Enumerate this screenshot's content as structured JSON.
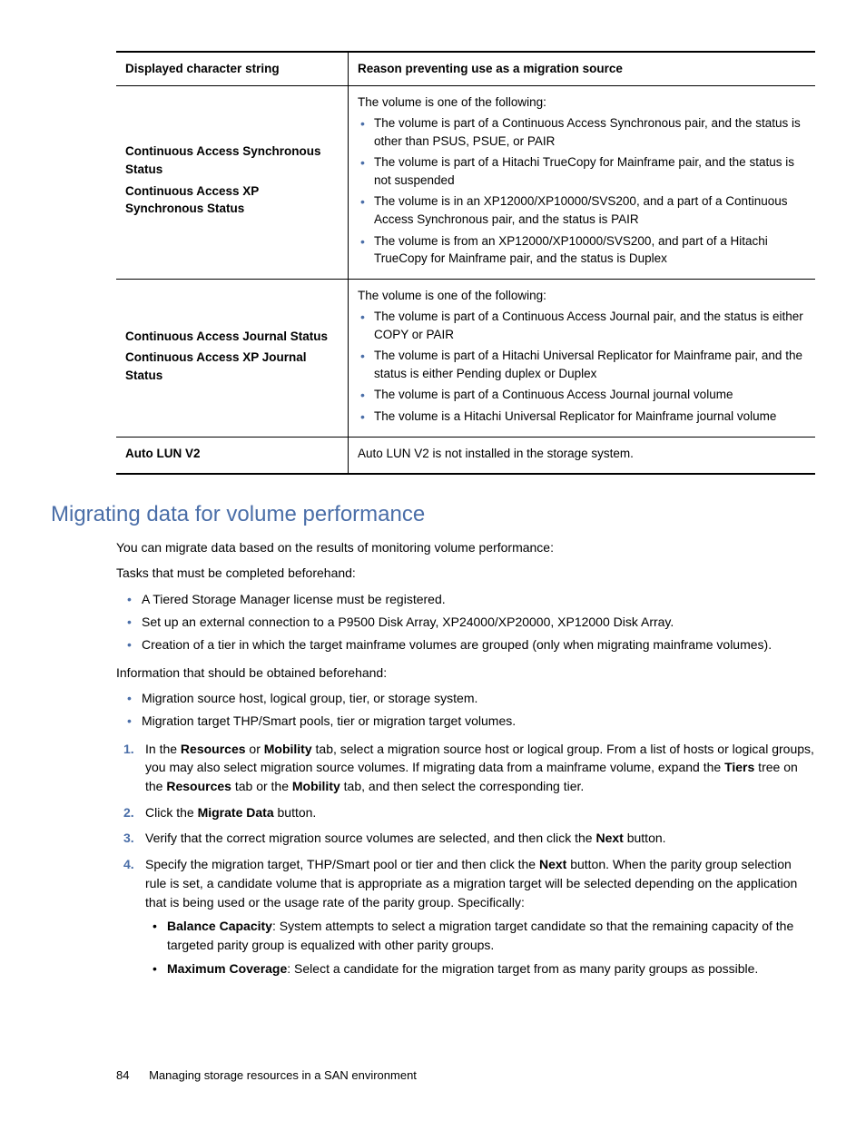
{
  "table": {
    "headers": [
      "Displayed character string",
      "Reason preventing use as a migration source"
    ],
    "rows": [
      {
        "labels": [
          "Continuous Access Synchronous Status",
          "Continuous Access XP Synchronous Status"
        ],
        "intro": "The volume is one of the following:",
        "items": [
          "The volume is part of a Continuous Access Synchronous pair, and the status is other than PSUS, PSUE, or PAIR",
          "The volume is part of a Hitachi TrueCopy for Mainframe pair, and the status is not suspended",
          "The volume is in an XP12000/XP10000/SVS200, and a part of a Continuous Access Synchronous pair, and the status is PAIR",
          "The volume is from an XP12000/XP10000/SVS200, and part of a Hitachi TrueCopy for Mainframe pair, and the status is Duplex"
        ]
      },
      {
        "labels": [
          "Continuous Access Journal Status",
          "Continuous Access XP Journal Status"
        ],
        "intro": "The volume is one of the following:",
        "items": [
          "The volume is part of a Continuous Access Journal pair, and the status is either COPY or PAIR",
          "The volume is part of a Hitachi Universal Replicator for Mainframe pair, and the status is either Pending duplex or Duplex",
          "The volume is part of a Continuous Access Journal journal volume",
          "The volume is a Hitachi Universal Replicator for Mainframe journal volume"
        ]
      },
      {
        "labels": [
          "Auto LUN V2"
        ],
        "intro": "Auto LUN V2 is not installed in the storage system.",
        "items": []
      }
    ]
  },
  "section": {
    "heading": "Migrating data for volume performance",
    "intro1": "You can migrate data based on the results of monitoring volume performance:",
    "intro2": "Tasks that must be completed beforehand:",
    "tasks": [
      "A Tiered Storage Manager license must be registered.",
      "Set up an external connection to a P9500 Disk Array, XP24000/XP20000, XP12000 Disk Array.",
      "Creation of a tier in which the target mainframe volumes are grouped (only when migrating mainframe volumes)."
    ],
    "intro3": "Information that should be obtained beforehand:",
    "info": [
      "Migration source host, logical group, tier, or storage system.",
      "Migration target THP/Smart pools, tier or migration target volumes."
    ],
    "steps": [
      {
        "pre": "In the ",
        "b1": "Resources",
        "mid1": " or ",
        "b2": "Mobility",
        "post1": " tab, select a migration source host or logical group. From a list of hosts or logical groups, you may also select migration source volumes. If migrating data from a mainframe volume, expand the ",
        "b3": "Tiers",
        "post2": " tree on the ",
        "b4": "Resources",
        "post3": " tab or the ",
        "b5": "Mobility",
        "post4": " tab, and then select the corresponding tier."
      },
      {
        "pre": "Click the ",
        "b1": "Migrate Data",
        "post1": " button."
      },
      {
        "pre": "Verify that the correct migration source volumes are selected, and then click the ",
        "b1": "Next",
        "post1": " button."
      },
      {
        "pre": "Specify the migration target, THP/Smart pool or tier and then click the ",
        "b1": "Next",
        "post1": " button. When the parity group selection rule is set, a candidate volume that is appropriate as a migration target will be selected depending on the application that is being used or the usage rate of the parity group. Specifically:",
        "sub": [
          {
            "b": "Balance Capacity",
            "t": ": System attempts to select a migration target candidate so that the remaining capacity of the targeted parity group is equalized with other parity groups."
          },
          {
            "b": "Maximum Coverage",
            "t": ": Select a candidate for the migration target from as many parity groups as possible."
          }
        ]
      }
    ]
  },
  "footer": {
    "page": "84",
    "title": "Managing storage resources in a SAN environment"
  }
}
